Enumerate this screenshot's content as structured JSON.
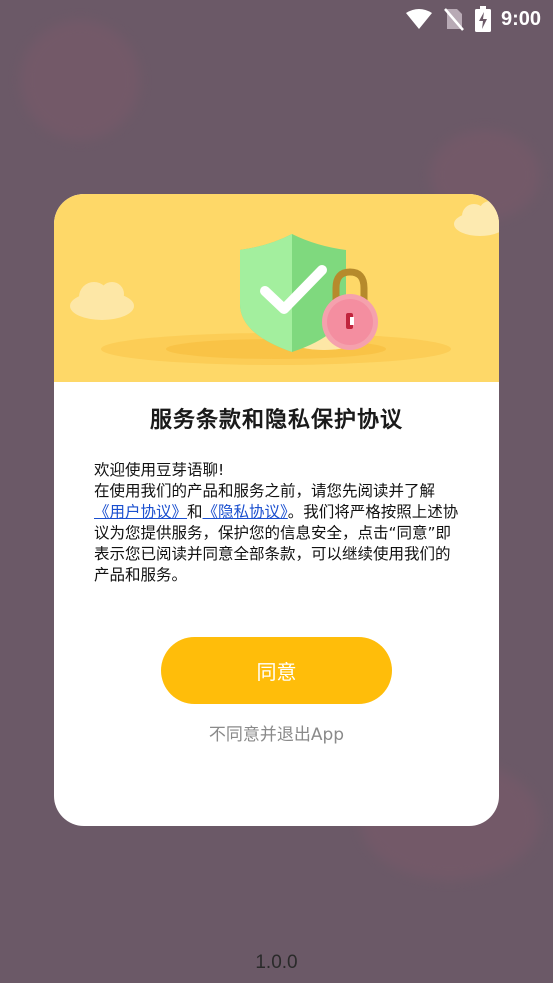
{
  "status_bar": {
    "time": "9:00",
    "icons": [
      "wifi-icon",
      "no-sim-icon",
      "battery-charging-icon"
    ]
  },
  "dialog": {
    "title": "服务条款和隐私保护协议",
    "body": {
      "greeting": "欢迎使用豆芽语聊!",
      "intro": "在使用我们的产品和服务之前，请您先阅读并了解",
      "user_agreement_link": "《用户协议》",
      "and": "和",
      "privacy_link": "《隐私协议》",
      "rest": "。我们将严格按照上述协议为您提供服务，保护您的信息安全，点击“同意”即表示您已阅读并同意全部条款，可以继续使用我们的产品和服务。"
    },
    "agree_label": "同意",
    "disagree_label": "不同意并退出App"
  },
  "footer": {
    "version": "1.0.0"
  },
  "colors": {
    "header_bg": "#fed868",
    "button_bg": "#ffbd0a",
    "shield": "#8fe28a",
    "lock_body": "#f48ea0",
    "link": "#1a4fcf"
  }
}
